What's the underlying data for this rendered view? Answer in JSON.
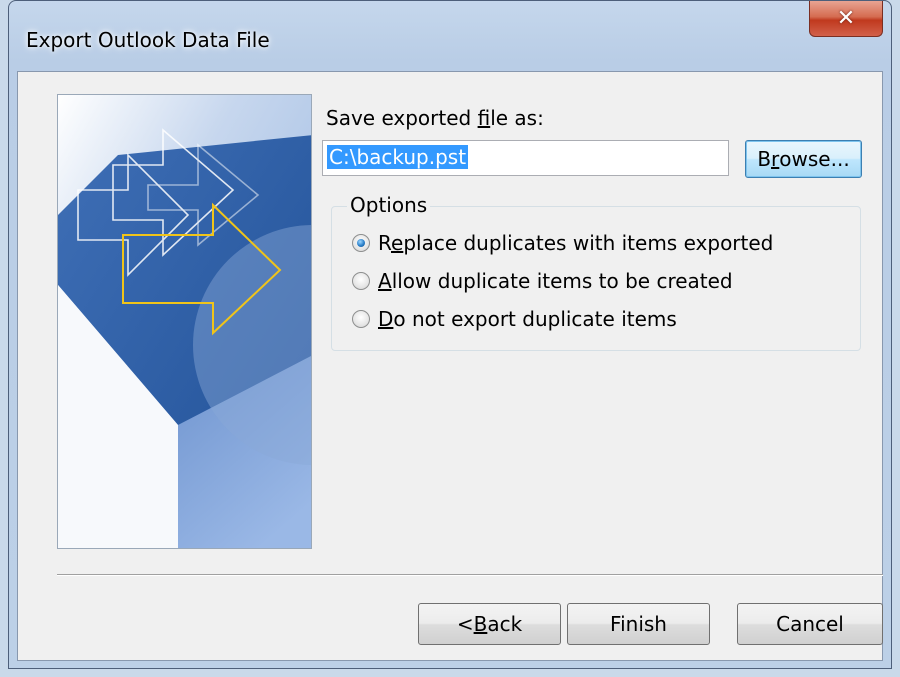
{
  "window": {
    "title": "Export Outlook Data File",
    "close_glyph": "✕"
  },
  "main": {
    "save_label_parts": [
      "Save exported ",
      "f",
      "ile as:"
    ],
    "file_path": "C:\\backup.pst",
    "browse_parts": [
      "B",
      "r",
      "owse..."
    ]
  },
  "options": {
    "legend": "Options",
    "items": [
      {
        "parts": [
          "R",
          "e",
          "place duplicates with items exported"
        ],
        "selected": true
      },
      {
        "parts": [
          "",
          "A",
          "llow duplicate items to be created"
        ],
        "selected": false
      },
      {
        "parts": [
          "",
          "D",
          "o not export duplicate items"
        ],
        "selected": false
      }
    ]
  },
  "buttons": {
    "back_parts": [
      "< ",
      "B",
      "ack"
    ],
    "finish": "Finish",
    "cancel": "Cancel"
  },
  "colors": {
    "selection": "#3399ff",
    "art_blue": "#2f5da3",
    "art_arrow_outline": "#f0c419"
  }
}
